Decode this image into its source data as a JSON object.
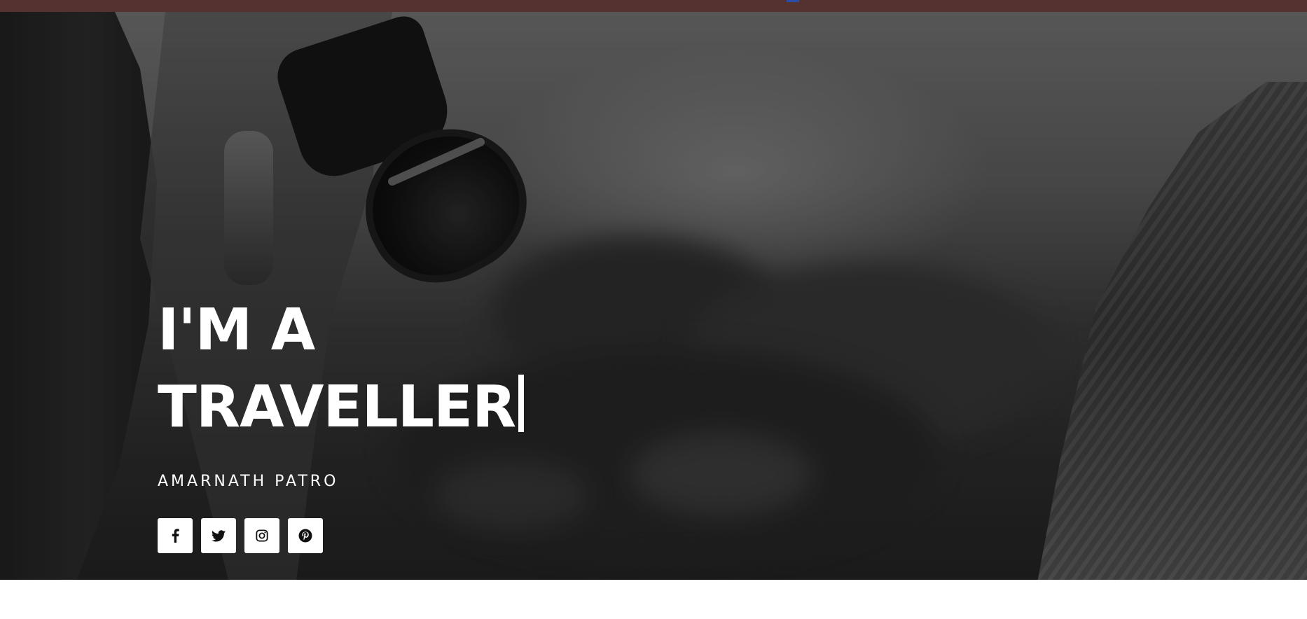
{
  "hero": {
    "title_line1": "I'M A",
    "title_line2": "TRAVELLER",
    "subtitle": "AMARNATH PATRO"
  },
  "social": [
    {
      "icon": "facebook-icon"
    },
    {
      "icon": "twitter-icon"
    },
    {
      "icon": "instagram-icon"
    },
    {
      "icon": "pinterest-icon"
    }
  ],
  "colors": {
    "topbar": "#553230",
    "topbar_marker": "#2a4fa8",
    "hero_text": "#ffffff",
    "social_bg": "#ffffff",
    "social_icon": "#111111"
  }
}
